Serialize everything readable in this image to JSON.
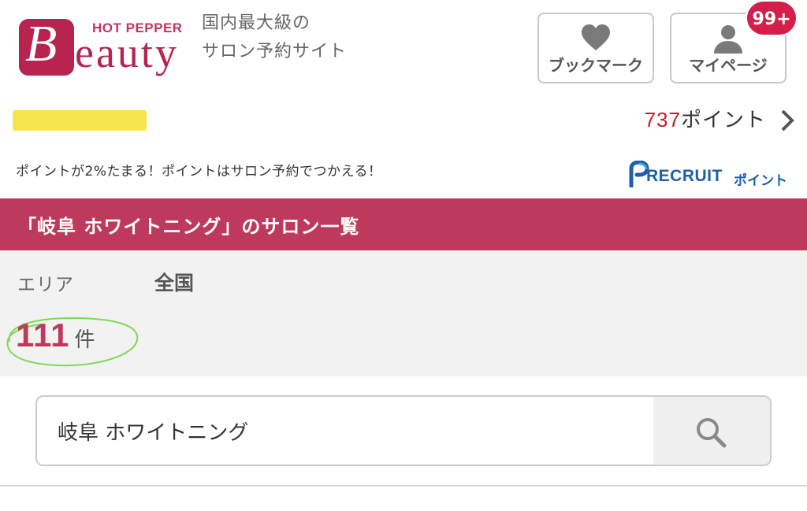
{
  "header": {
    "logo_top": "HOT PEPPER",
    "logo_initial": "B",
    "logo_word": "eauty",
    "tagline_line1": "国内最大級の",
    "tagline_line2": "サロン予約サイト",
    "bookmark_label": "ブックマーク",
    "mypage_label": "マイページ",
    "notification_badge": "99+"
  },
  "user": {
    "points_value": "737",
    "points_unit": "ポイント"
  },
  "notice": {
    "text": "ポイントが2%たまる！ポイントはサロン予約でつかえる！",
    "recruit_word": "RECRUIT",
    "recruit_point": "ポイント"
  },
  "page_title": "「岐阜 ホワイトニング」のサロン一覧",
  "area": {
    "label": "エリア",
    "value": "全国"
  },
  "results": {
    "count": "111",
    "unit": "件"
  },
  "search": {
    "value": "岐阜 ホワイトニング"
  },
  "colors": {
    "brand": "#be3a5d",
    "badge": "#d41f4a",
    "points_number": "#c22027",
    "recruit_blue": "#1d5fa8",
    "highlight": "#f6e54a",
    "circle_annotation": "#7ed957"
  },
  "icons": [
    "heart-icon",
    "person-icon",
    "chevron-right-icon",
    "search-icon",
    "recruit-logo"
  ]
}
